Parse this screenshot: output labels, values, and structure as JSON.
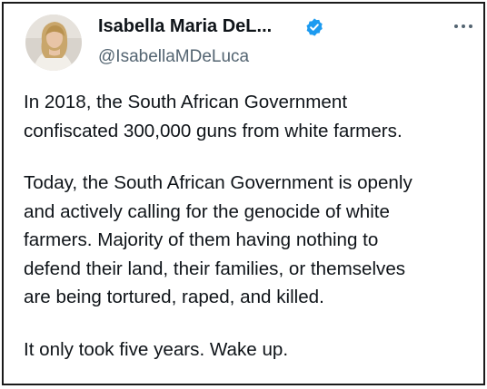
{
  "tweet": {
    "author": {
      "display_name": "Isabella Maria DeL...",
      "handle": "@IsabellaMDeLuca",
      "verified": true,
      "avatar_icon": "profile-photo"
    },
    "more_icon": "more-options-icon",
    "paragraphs": [
      [
        "In 2018, the South African Government",
        "confiscated 300,000 guns from white farmers."
      ],
      [
        "Today, the South African Government is openly",
        "and actively calling for the genocide of white",
        "farmers. Majority of them having nothing to",
        "defend their land, their families, or themselves",
        "are being tortured, raped, and killed."
      ],
      [
        "It only took five years. Wake up."
      ]
    ]
  },
  "colors": {
    "verified_badge": "#1d9bf0",
    "text_primary": "#0f1419",
    "text_secondary": "#536471",
    "border": "#1a1a1a"
  }
}
